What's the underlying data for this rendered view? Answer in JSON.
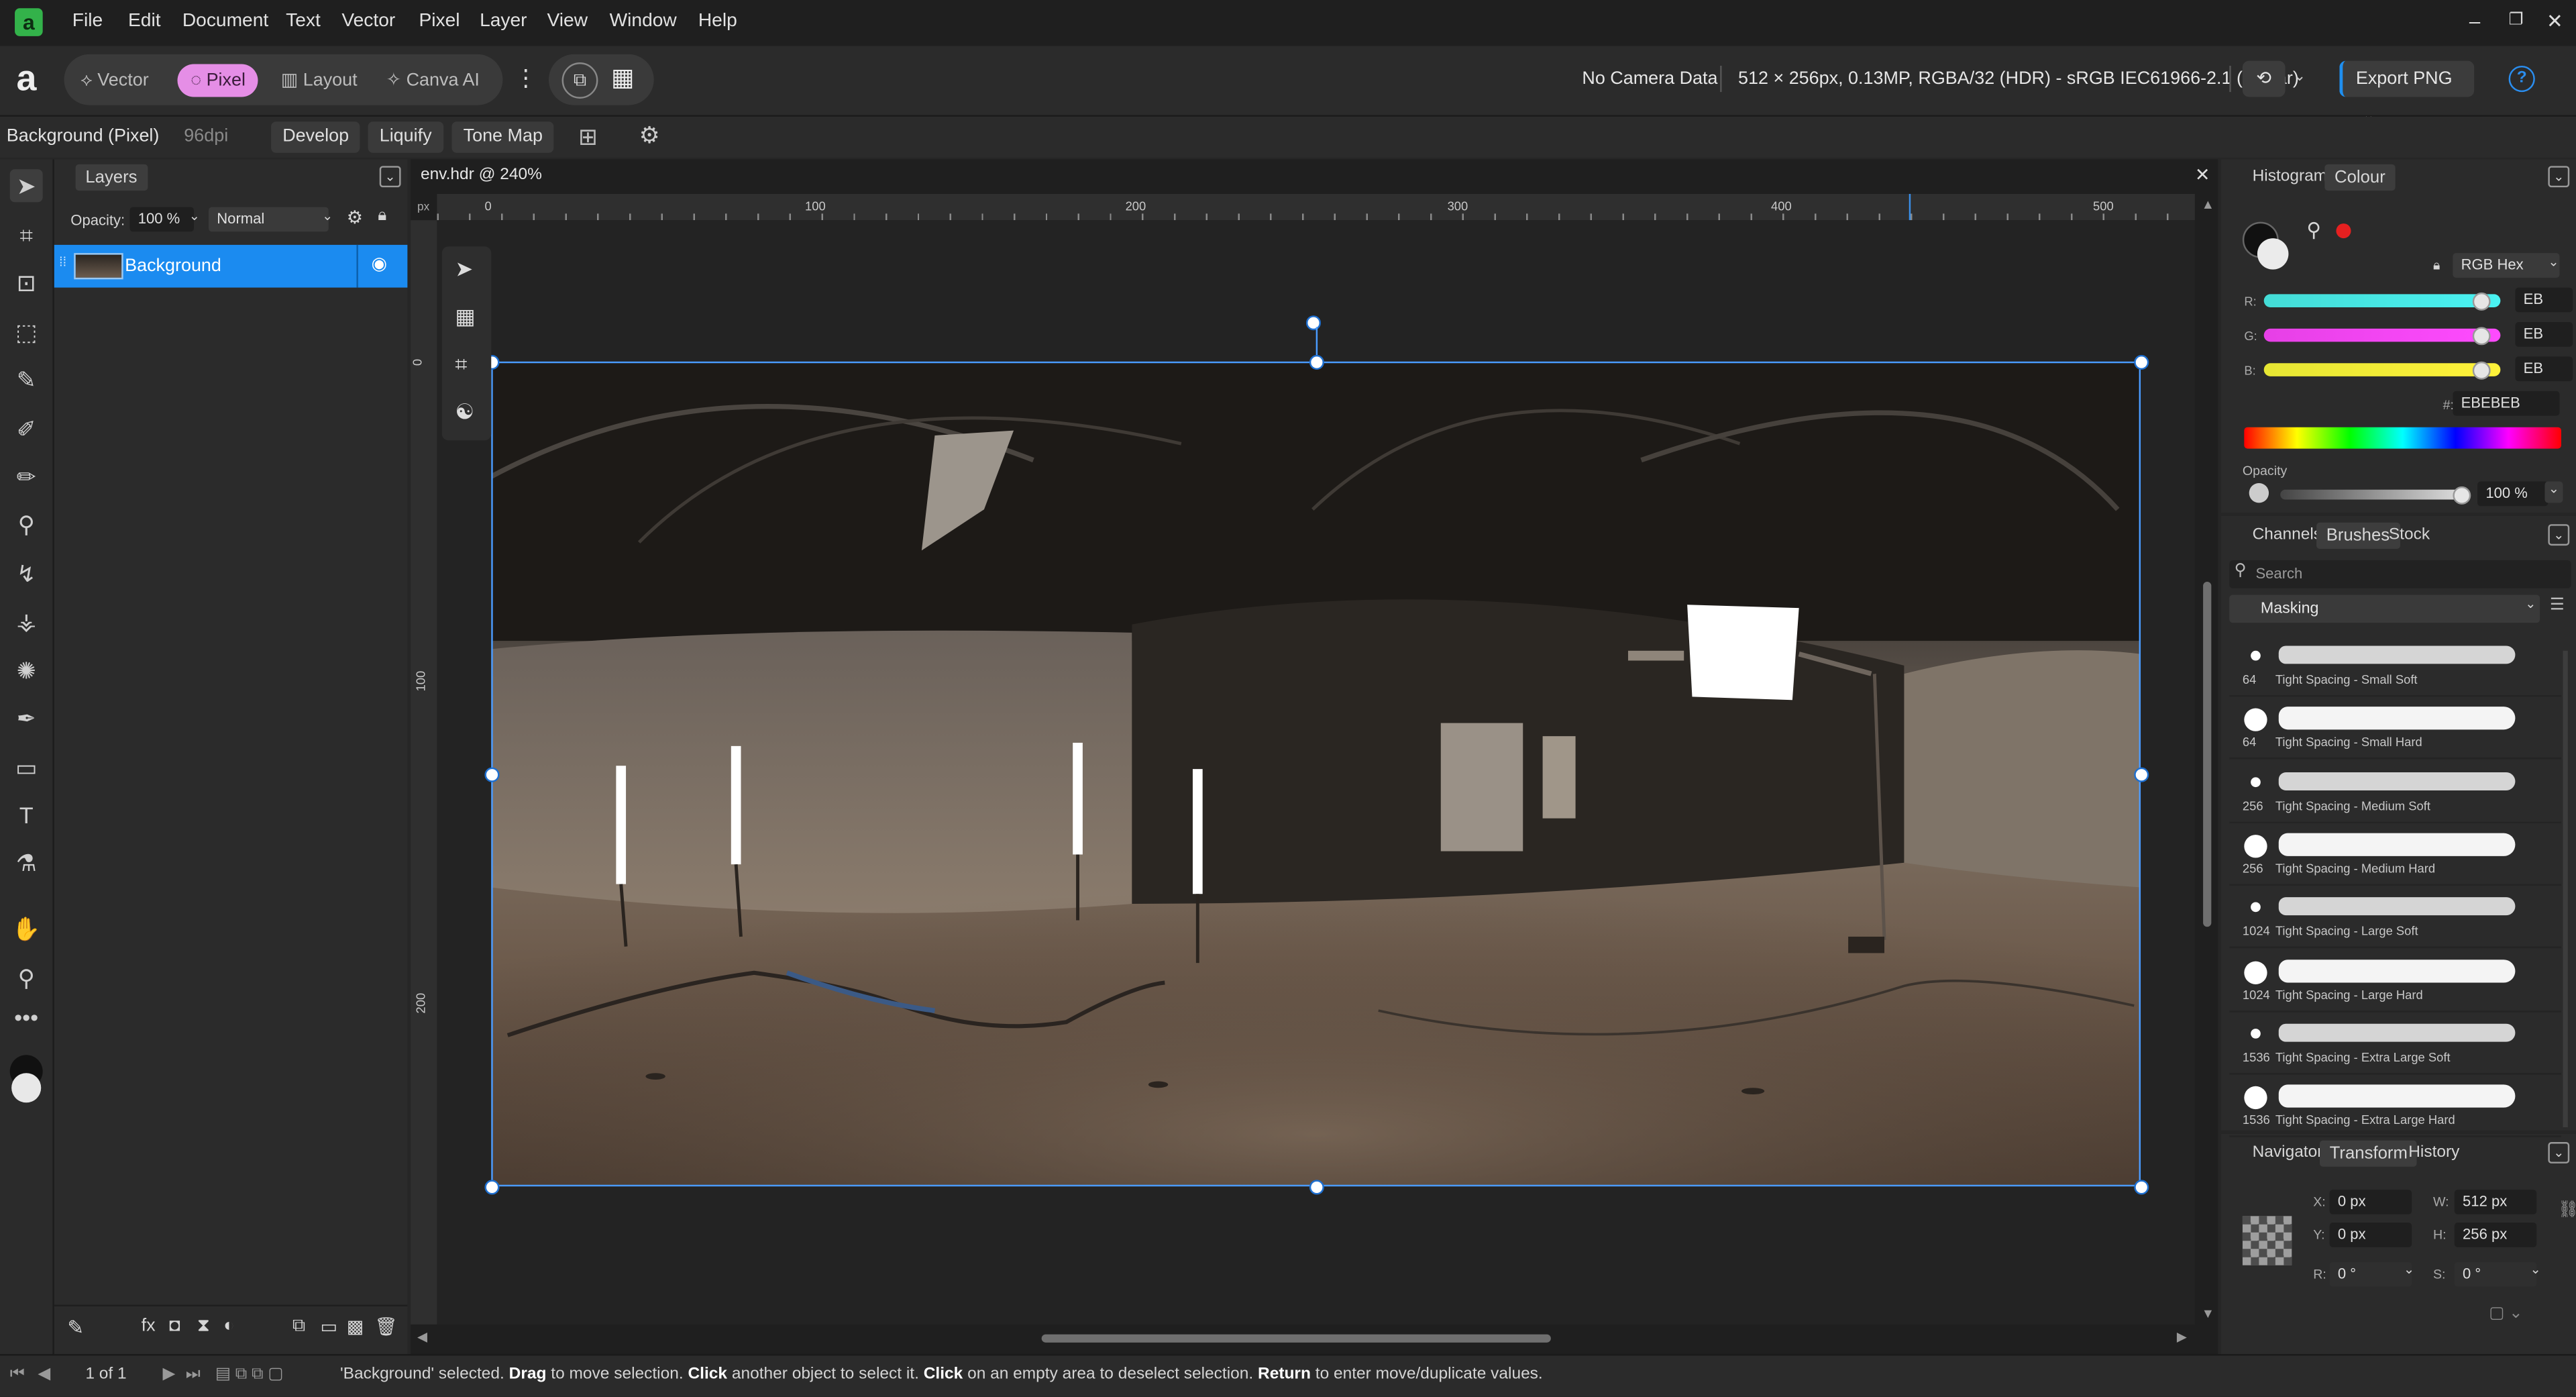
{
  "menu": [
    "File",
    "Edit",
    "Document",
    "Text",
    "Vector",
    "Pixel",
    "Layer",
    "View",
    "Window",
    "Help"
  ],
  "window_controls": {
    "minimize": "–",
    "restore": "❐",
    "close": "✕"
  },
  "personas": {
    "vector": "Vector",
    "pixel": "Pixel",
    "layout": "Layout",
    "canva": "Canva AI"
  },
  "toolbar": {
    "camera": "No Camera Data",
    "doc_info": "512 × 256px, 0.13MP, RGBA/32 (HDR) - sRGB IEC61966-2.1 (Linear)",
    "export": "Export PNG"
  },
  "context": {
    "layer_type": "Background (Pixel)",
    "dpi": "96dpi",
    "develop": "Develop",
    "liquify": "Liquify",
    "tonemap": "Tone Map"
  },
  "layers_panel": {
    "title": "Layers",
    "opacity_label": "Opacity:",
    "opacity_value": "100 %",
    "blend_mode": "Normal",
    "layer_name": "Background"
  },
  "document": {
    "tab": "env.hdr @ 240%",
    "ruler_unit": "px",
    "ruler_h_ticks": [
      "0",
      "100",
      "200",
      "300",
      "400",
      "500"
    ],
    "ruler_v_ticks": [
      "0",
      "100",
      "200"
    ]
  },
  "colour_panel": {
    "tabs": [
      "Histogram",
      "Colour"
    ],
    "active_tab": "Colour",
    "model": "RGB Hex",
    "r_label": "R:",
    "g_label": "G:",
    "b_label": "B:",
    "r": "EB",
    "g": "EB",
    "b": "EB",
    "hex_label": "#:",
    "hex": "EBEBEB",
    "opacity_label": "Opacity",
    "opacity": "100 %",
    "r_level": 0.92,
    "g_level": 0.92,
    "b_level": 0.92,
    "opacity_level": 1.0,
    "colors": {
      "r_track": "#3ee6f0",
      "g_track": "#ff35ff",
      "b_track": "#fdf33a",
      "accent": "#e52020"
    }
  },
  "brushes_panel": {
    "tabs": [
      "Channels",
      "Brushes",
      "Stock"
    ],
    "active_tab": "Brushes",
    "search_placeholder": "Search",
    "category": "Masking",
    "items": [
      {
        "size": "64",
        "name": "Tight Spacing - Small Soft",
        "soft": true
      },
      {
        "size": "64",
        "name": "Tight Spacing - Small Hard",
        "soft": false
      },
      {
        "size": "256",
        "name": "Tight Spacing - Medium Soft",
        "soft": true
      },
      {
        "size": "256",
        "name": "Tight Spacing - Medium Hard",
        "soft": false
      },
      {
        "size": "1024",
        "name": "Tight Spacing - Large Soft",
        "soft": true
      },
      {
        "size": "1024",
        "name": "Tight Spacing - Large Hard",
        "soft": false
      },
      {
        "size": "1536",
        "name": "Tight Spacing - Extra Large Soft",
        "soft": true
      },
      {
        "size": "1536",
        "name": "Tight Spacing - Extra Large Hard",
        "soft": false
      }
    ]
  },
  "transform_panel": {
    "tabs": [
      "Navigator",
      "Transform",
      "History"
    ],
    "active_tab": "Transform",
    "x_label": "X:",
    "y_label": "Y:",
    "w_label": "W:",
    "h_label": "H:",
    "r_label": "R:",
    "s_label": "S:",
    "x": "0 px",
    "y": "0 px",
    "w": "512 px",
    "h": "256 px",
    "r": "0 °",
    "s": "0 °"
  },
  "status": {
    "page": "1 of 1",
    "message_parts": [
      {
        "text": "'Background' selected. ",
        "bold": false
      },
      {
        "text": "Drag",
        "bold": true
      },
      {
        "text": " to move selection. ",
        "bold": false
      },
      {
        "text": "Click",
        "bold": true
      },
      {
        "text": " another object to select it. ",
        "bold": false
      },
      {
        "text": "Click",
        "bold": true
      },
      {
        "text": " on an empty area to deselect selection. ",
        "bold": false
      },
      {
        "text": "Return",
        "bold": true
      },
      {
        "text": " to enter move/duplicate values.",
        "bold": false
      }
    ]
  }
}
